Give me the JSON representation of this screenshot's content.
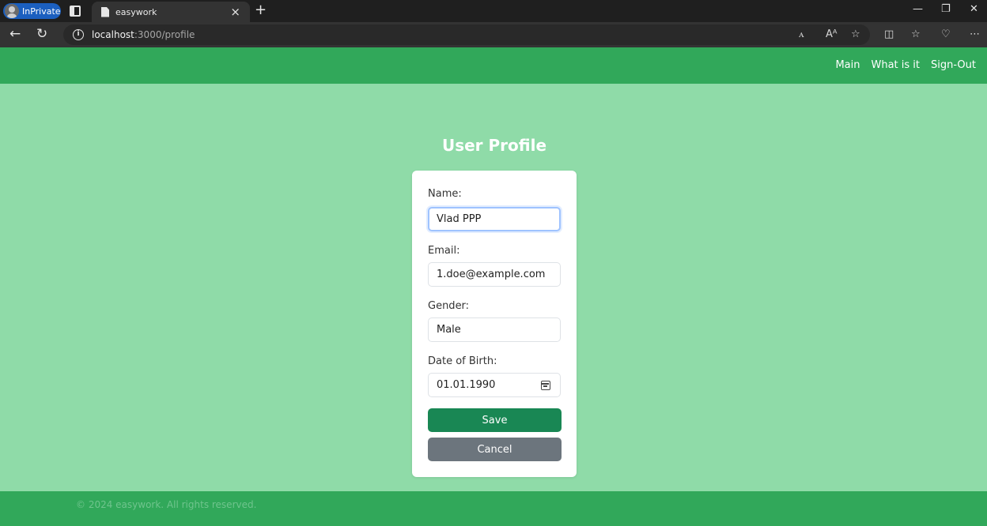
{
  "browser": {
    "inprivate_label": "InPrivate",
    "tab_title": "easywork",
    "tab_close": "×",
    "new_tab": "+",
    "url_host": "localhost",
    "url_path": ":3000/profile",
    "icons": [
      "back-icon",
      "refresh-icon",
      "info-icon",
      "read-aloud-icon",
      "favorite-icon",
      "split-screen-icon",
      "favorites-icon",
      "health-icon",
      "more-icon"
    ]
  },
  "navbar": {
    "links": [
      "Main",
      "What is it",
      "Sign-Out"
    ]
  },
  "profile": {
    "title": "User Profile",
    "name_label": "Name:",
    "name_value": "Vlad PPP",
    "email_label": "Email:",
    "email_value": "1.doe@example.com",
    "gender_label": "Gender:",
    "gender_value": "Male",
    "dob_label": "Date of Birth:",
    "dob_value": "01.01.1990",
    "save_label": "Save",
    "cancel_label": "Cancel"
  },
  "footer": {
    "text": "© 2024 easywork. All rights reserved."
  },
  "colors": {
    "navbar": "#31a85a",
    "background": "#8fdba8",
    "save_button": "#198754",
    "cancel_button": "#6c757d"
  }
}
